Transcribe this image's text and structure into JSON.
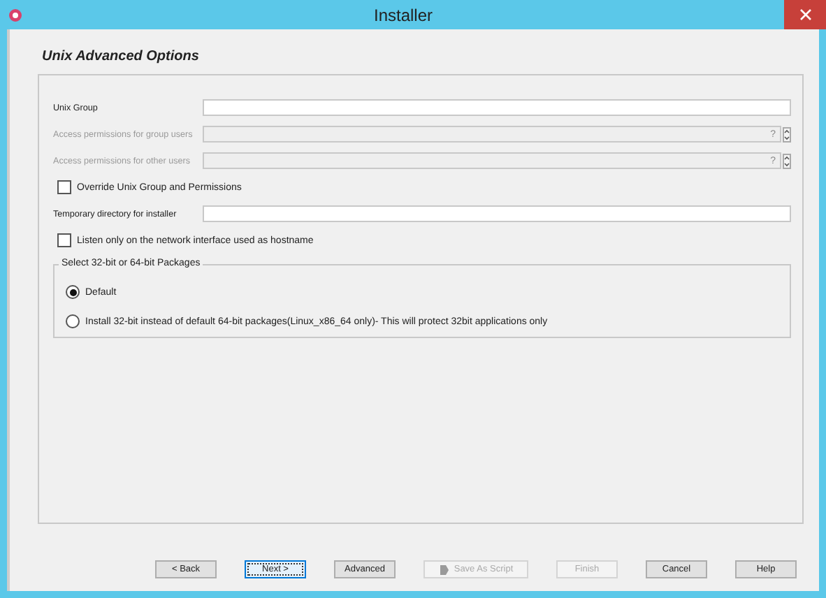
{
  "window": {
    "title": "Installer"
  },
  "heading": "Unix Advanced Options",
  "fields_top": [
    {
      "kind": "text",
      "label": "Unix Group",
      "disabled": false
    },
    {
      "kind": "spinner",
      "label": "Access permissions for group users",
      "disabled": true,
      "value": "?"
    },
    {
      "kind": "spinner",
      "label": "Access permissions for other users",
      "disabled": true,
      "value": "?"
    }
  ],
  "override_checkbox": {
    "label": "Override Unix Group and Permissions",
    "checked": false
  },
  "temp_dir": {
    "kind": "text",
    "label": "Temporary directory for installer",
    "disabled": false
  },
  "listen_checkbox": {
    "label": "Listen only on the network interface used as hostname",
    "checked": false
  },
  "packages_group": {
    "title": "Select 32-bit or 64-bit Packages",
    "options": [
      {
        "label": "Default",
        "selected": true
      },
      {
        "label": "Install 32-bit instead of default 64-bit packages(Linux_x86_64 only)- This will protect 32bit applications only",
        "selected": false
      }
    ]
  },
  "buttons": [
    {
      "label": "< Back",
      "disabled": false,
      "focused": false
    },
    {
      "label": "Next >",
      "disabled": false,
      "focused": true
    },
    {
      "label": "Advanced",
      "disabled": false,
      "focused": false
    },
    {
      "label": "Save As Script",
      "disabled": true,
      "focused": false,
      "icon": true
    },
    {
      "label": "Finish",
      "disabled": true,
      "focused": false
    },
    {
      "label": "Cancel",
      "disabled": false,
      "focused": false
    },
    {
      "label": "Help",
      "disabled": false,
      "focused": false
    }
  ]
}
